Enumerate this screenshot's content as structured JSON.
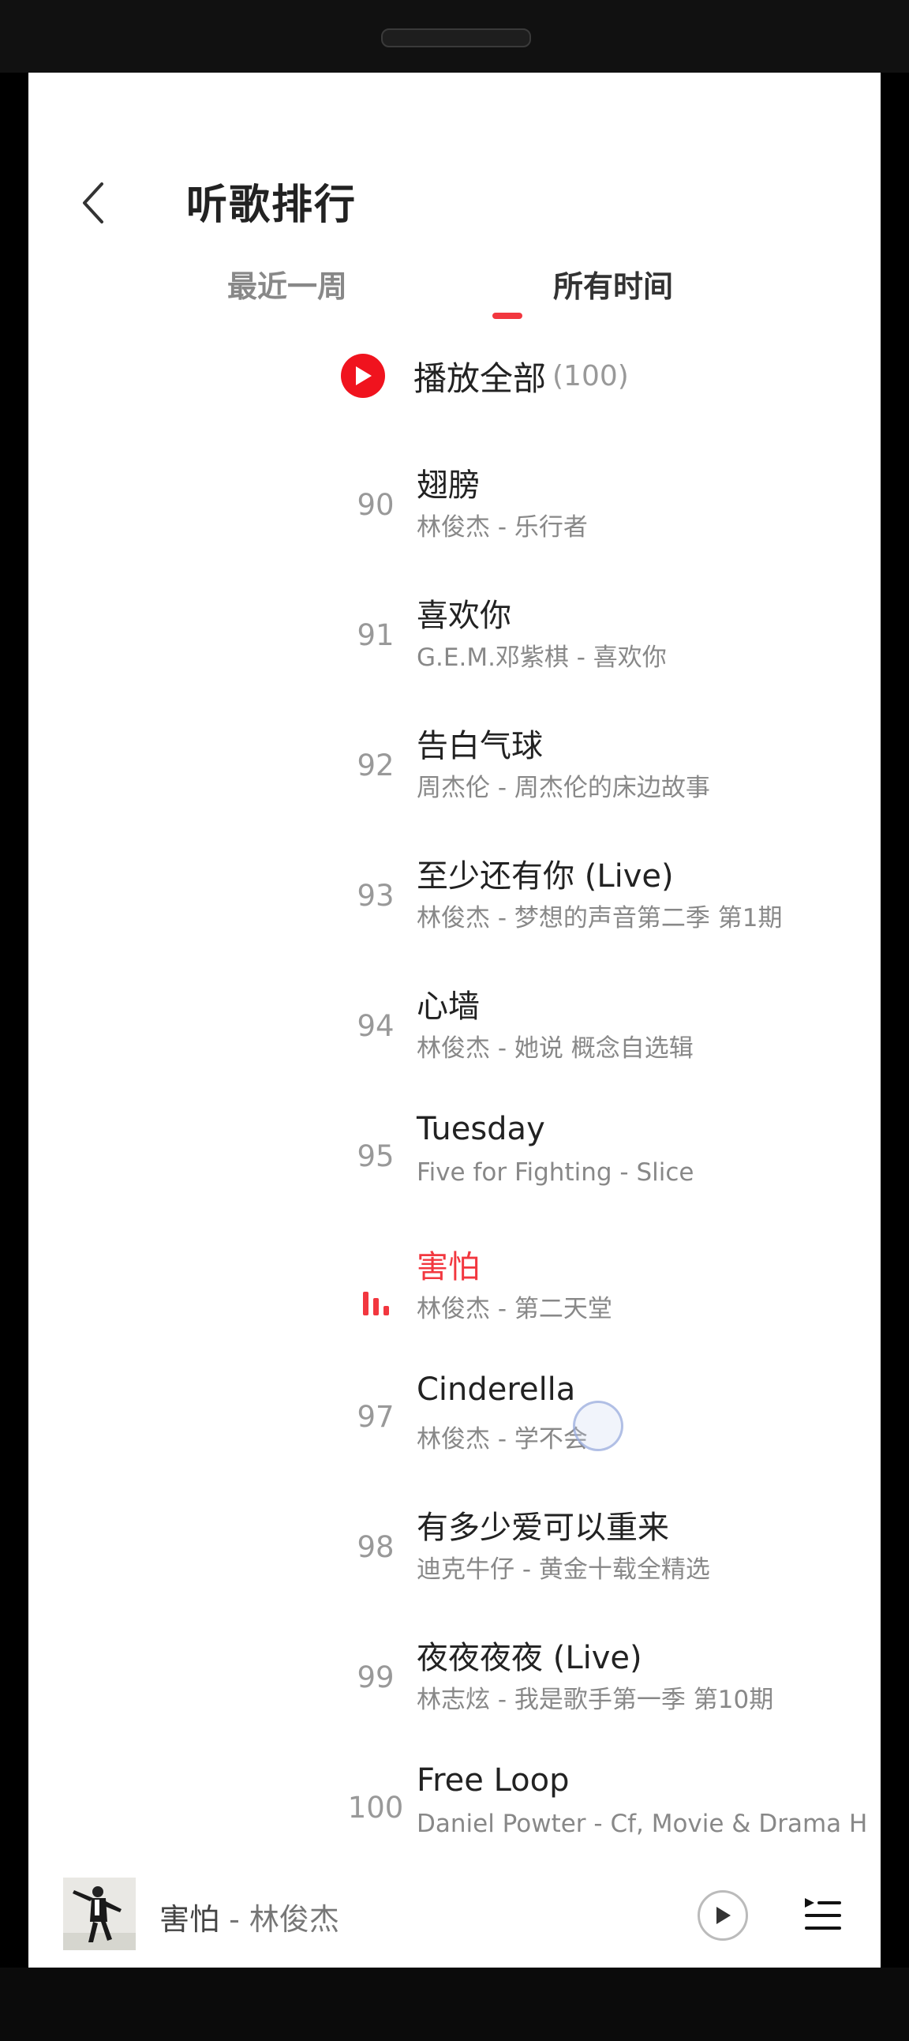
{
  "header": {
    "title": "听歌排行"
  },
  "tabs": [
    {
      "label": "最近一周",
      "active": false
    },
    {
      "label": "所有时间",
      "active": true
    }
  ],
  "play_all": {
    "label": "播放全部",
    "count": "(100)"
  },
  "songs": [
    {
      "rank": "90",
      "title": "翅膀",
      "subtitle": "林俊杰 - 乐行者",
      "playing": false
    },
    {
      "rank": "91",
      "title": "喜欢你",
      "subtitle": "G.E.M.邓紫棋 - 喜欢你",
      "playing": false
    },
    {
      "rank": "92",
      "title": "告白气球",
      "subtitle": "周杰伦 - 周杰伦的床边故事",
      "playing": false
    },
    {
      "rank": "93",
      "title": "至少还有你 (Live)",
      "subtitle": "林俊杰 - 梦想的声音第二季 第1期",
      "playing": false
    },
    {
      "rank": "94",
      "title": "心墙",
      "subtitle": "林俊杰 - 她说 概念自选辑",
      "playing": false
    },
    {
      "rank": "95",
      "title": "Tuesday",
      "subtitle": "Five for Fighting - Slice",
      "playing": false
    },
    {
      "rank": "",
      "title": "害怕",
      "subtitle": "林俊杰 - 第二天堂",
      "playing": true
    },
    {
      "rank": "97",
      "title": "Cinderella",
      "subtitle": "林俊杰 - 学不会",
      "playing": false
    },
    {
      "rank": "98",
      "title": "有多少爱可以重来",
      "subtitle": "迪克牛仔 - 黄金十载全精选",
      "playing": false
    },
    {
      "rank": "99",
      "title": "夜夜夜夜 (Live)",
      "subtitle": "林志炫 - 我是歌手第一季 第10期",
      "playing": false
    },
    {
      "rank": "100",
      "title": "Free Loop",
      "subtitle": "Daniel Powter - Cf, Movie & Drama H",
      "playing": false
    }
  ],
  "mini_player": {
    "title": "害怕",
    "separator": " - ",
    "artist": "林俊杰"
  },
  "icons": {
    "back": "chevron-left-icon",
    "play_all": "play-circle-icon",
    "now_playing": "equalizer-icon",
    "mini_play": "play-icon",
    "playlist": "playlist-icon"
  },
  "colors": {
    "accent": "#f2373f",
    "play_button": "#f0131e",
    "text_primary": "#222222",
    "text_secondary": "#888888"
  }
}
